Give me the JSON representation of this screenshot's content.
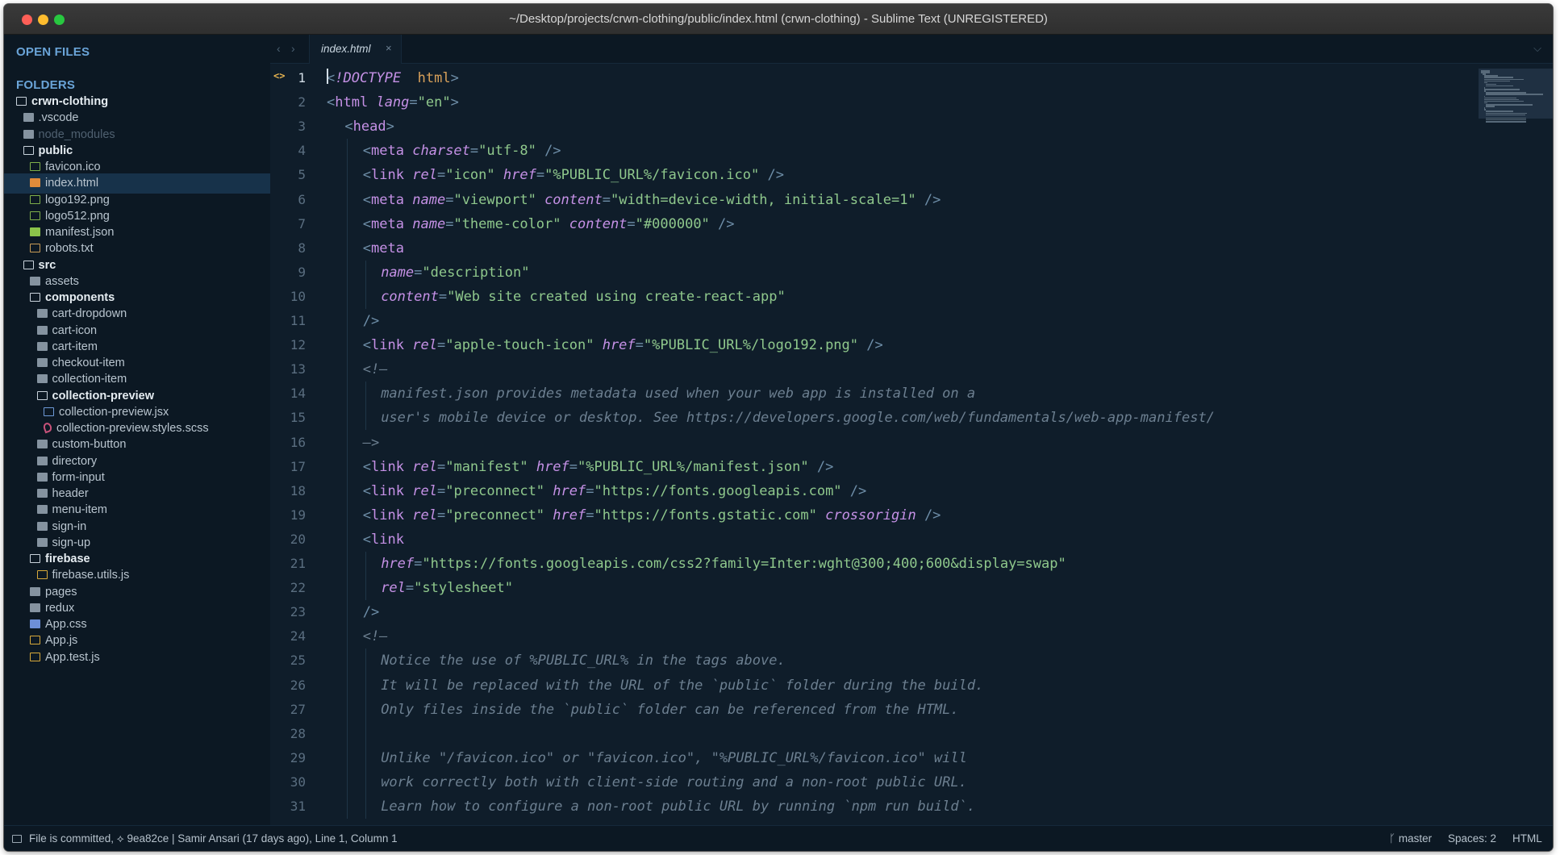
{
  "window": {
    "title": "~/Desktop/projects/crwn-clothing/public/index.html (crwn-clothing) - Sublime Text (UNREGISTERED)"
  },
  "sidebar": {
    "open_files_heading": "OPEN FILES",
    "folders_heading": "FOLDERS",
    "tree": [
      {
        "label": "crwn-clothing",
        "indent": 0,
        "icon": "folder-open-icon",
        "kind": "folder-open"
      },
      {
        "label": ".vscode",
        "indent": 1,
        "icon": "folder-icon",
        "kind": "folder"
      },
      {
        "label": "node_modules",
        "indent": 1,
        "icon": "folder-icon",
        "kind": "dim"
      },
      {
        "label": "public",
        "indent": 1,
        "icon": "folder-open-icon",
        "kind": "folder-open"
      },
      {
        "label": "favicon.ico",
        "indent": 2,
        "icon": "image-file-icon",
        "kind": "file"
      },
      {
        "label": "index.html",
        "indent": 2,
        "icon": "html-file-icon",
        "kind": "file",
        "selected": true
      },
      {
        "label": "logo192.png",
        "indent": 2,
        "icon": "image-file-icon",
        "kind": "file"
      },
      {
        "label": "logo512.png",
        "indent": 2,
        "icon": "image-file-icon",
        "kind": "file"
      },
      {
        "label": "manifest.json",
        "indent": 2,
        "icon": "json-file-icon",
        "kind": "file"
      },
      {
        "label": "robots.txt",
        "indent": 2,
        "icon": "text-file-icon",
        "kind": "file"
      },
      {
        "label": "src",
        "indent": 1,
        "icon": "folder-open-icon",
        "kind": "folder-open"
      },
      {
        "label": "assets",
        "indent": 2,
        "icon": "folder-icon",
        "kind": "folder"
      },
      {
        "label": "components",
        "indent": 2,
        "icon": "folder-open-icon",
        "kind": "folder-open"
      },
      {
        "label": "cart-dropdown",
        "indent": 3,
        "icon": "folder-icon",
        "kind": "folder"
      },
      {
        "label": "cart-icon",
        "indent": 3,
        "icon": "folder-icon",
        "kind": "folder"
      },
      {
        "label": "cart-item",
        "indent": 3,
        "icon": "folder-icon",
        "kind": "folder"
      },
      {
        "label": "checkout-item",
        "indent": 3,
        "icon": "folder-icon",
        "kind": "folder"
      },
      {
        "label": "collection-item",
        "indent": 3,
        "icon": "folder-icon",
        "kind": "folder"
      },
      {
        "label": "collection-preview",
        "indent": 3,
        "icon": "folder-open-icon",
        "kind": "folder-open"
      },
      {
        "label": "collection-preview.jsx",
        "indent": 4,
        "icon": "jsx-file-icon",
        "kind": "file"
      },
      {
        "label": "collection-preview.styles.scss",
        "indent": 4,
        "icon": "sass-file-icon",
        "kind": "file"
      },
      {
        "label": "custom-button",
        "indent": 3,
        "icon": "folder-icon",
        "kind": "folder"
      },
      {
        "label": "directory",
        "indent": 3,
        "icon": "folder-icon",
        "kind": "folder"
      },
      {
        "label": "form-input",
        "indent": 3,
        "icon": "folder-icon",
        "kind": "folder"
      },
      {
        "label": "header",
        "indent": 3,
        "icon": "folder-icon",
        "kind": "folder"
      },
      {
        "label": "menu-item",
        "indent": 3,
        "icon": "folder-icon",
        "kind": "folder"
      },
      {
        "label": "sign-in",
        "indent": 3,
        "icon": "folder-icon",
        "kind": "folder"
      },
      {
        "label": "sign-up",
        "indent": 3,
        "icon": "folder-icon",
        "kind": "folder"
      },
      {
        "label": "firebase",
        "indent": 2,
        "icon": "folder-open-icon",
        "kind": "folder-open"
      },
      {
        "label": "firebase.utils.js",
        "indent": 3,
        "icon": "js-file-icon",
        "kind": "file"
      },
      {
        "label": "pages",
        "indent": 2,
        "icon": "folder-icon",
        "kind": "folder"
      },
      {
        "label": "redux",
        "indent": 2,
        "icon": "folder-icon",
        "kind": "folder"
      },
      {
        "label": "App.css",
        "indent": 2,
        "icon": "css-file-icon",
        "kind": "file"
      },
      {
        "label": "App.js",
        "indent": 2,
        "icon": "js-file-icon",
        "kind": "file"
      },
      {
        "label": "App.test.js",
        "indent": 2,
        "icon": "js-test-file-icon",
        "kind": "file"
      }
    ]
  },
  "tabs": [
    {
      "label": "index.html",
      "close": "×",
      "active": true
    }
  ],
  "tab_nav": {
    "back": "‹",
    "forward": "›",
    "dropdown": "⌵"
  },
  "editor": {
    "gutter_marker": "<>",
    "active_line": 1,
    "lines": [
      {
        "n": "1",
        "indent": 0,
        "tokens": [
          [
            "t-punct",
            "<"
          ],
          [
            "t-doc",
            "!DOCTYPE"
          ],
          [
            "",
            "  "
          ],
          [
            "t-name",
            "html"
          ],
          [
            "t-punct",
            ">"
          ]
        ]
      },
      {
        "n": "2",
        "indent": 0,
        "tokens": [
          [
            "t-punct",
            "<"
          ],
          [
            "t-tag",
            "html"
          ],
          [
            "",
            " "
          ],
          [
            "t-attr",
            "lang"
          ],
          [
            "t-punct",
            "="
          ],
          [
            "t-str",
            "\"en\""
          ],
          [
            "t-punct",
            ">"
          ]
        ]
      },
      {
        "n": "3",
        "indent": 1,
        "tokens": [
          [
            "t-punct",
            "<"
          ],
          [
            "t-tag",
            "head"
          ],
          [
            "t-punct",
            ">"
          ]
        ]
      },
      {
        "n": "4",
        "indent": 2,
        "tokens": [
          [
            "t-punct",
            "<"
          ],
          [
            "t-tag",
            "meta"
          ],
          [
            "",
            " "
          ],
          [
            "t-attr",
            "charset"
          ],
          [
            "t-punct",
            "="
          ],
          [
            "t-str",
            "\"utf-8\""
          ],
          [
            "",
            " "
          ],
          [
            "t-punct",
            "/>"
          ]
        ]
      },
      {
        "n": "5",
        "indent": 2,
        "tokens": [
          [
            "t-punct",
            "<"
          ],
          [
            "t-tag",
            "link"
          ],
          [
            "",
            " "
          ],
          [
            "t-attr",
            "rel"
          ],
          [
            "t-punct",
            "="
          ],
          [
            "t-str",
            "\"icon\""
          ],
          [
            "",
            " "
          ],
          [
            "t-attr",
            "href"
          ],
          [
            "t-punct",
            "="
          ],
          [
            "t-str",
            "\"%PUBLIC_URL%/favicon.ico\""
          ],
          [
            "",
            " "
          ],
          [
            "t-punct",
            "/>"
          ]
        ]
      },
      {
        "n": "6",
        "indent": 2,
        "tokens": [
          [
            "t-punct",
            "<"
          ],
          [
            "t-tag",
            "meta"
          ],
          [
            "",
            " "
          ],
          [
            "t-attr",
            "name"
          ],
          [
            "t-punct",
            "="
          ],
          [
            "t-str",
            "\"viewport\""
          ],
          [
            "",
            " "
          ],
          [
            "t-attr",
            "content"
          ],
          [
            "t-punct",
            "="
          ],
          [
            "t-str",
            "\"width=device-width, initial-scale=1\""
          ],
          [
            "",
            " "
          ],
          [
            "t-punct",
            "/>"
          ]
        ]
      },
      {
        "n": "7",
        "indent": 2,
        "tokens": [
          [
            "t-punct",
            "<"
          ],
          [
            "t-tag",
            "meta"
          ],
          [
            "",
            " "
          ],
          [
            "t-attr",
            "name"
          ],
          [
            "t-punct",
            "="
          ],
          [
            "t-str",
            "\"theme-color\""
          ],
          [
            "",
            " "
          ],
          [
            "t-attr",
            "content"
          ],
          [
            "t-punct",
            "="
          ],
          [
            "t-str",
            "\"#000000\""
          ],
          [
            "",
            " "
          ],
          [
            "t-punct",
            "/>"
          ]
        ]
      },
      {
        "n": "8",
        "indent": 2,
        "tokens": [
          [
            "t-punct",
            "<"
          ],
          [
            "t-tag",
            "meta"
          ]
        ]
      },
      {
        "n": "9",
        "indent": 3,
        "tokens": [
          [
            "t-attr",
            "name"
          ],
          [
            "t-punct",
            "="
          ],
          [
            "t-str",
            "\"description\""
          ]
        ]
      },
      {
        "n": "10",
        "indent": 3,
        "tokens": [
          [
            "t-attr",
            "content"
          ],
          [
            "t-punct",
            "="
          ],
          [
            "t-str",
            "\"Web site created using create-react-app\""
          ]
        ]
      },
      {
        "n": "11",
        "indent": 2,
        "tokens": [
          [
            "t-punct",
            "/>"
          ]
        ]
      },
      {
        "n": "12",
        "indent": 2,
        "tokens": [
          [
            "t-punct",
            "<"
          ],
          [
            "t-tag",
            "link"
          ],
          [
            "",
            " "
          ],
          [
            "t-attr",
            "rel"
          ],
          [
            "t-punct",
            "="
          ],
          [
            "t-str",
            "\"apple-touch-icon\""
          ],
          [
            "",
            " "
          ],
          [
            "t-attr",
            "href"
          ],
          [
            "t-punct",
            "="
          ],
          [
            "t-str",
            "\"%PUBLIC_URL%/logo192.png\""
          ],
          [
            "",
            " "
          ],
          [
            "t-punct",
            "/>"
          ]
        ]
      },
      {
        "n": "13",
        "indent": 2,
        "tokens": [
          [
            "t-com",
            "<!—"
          ]
        ]
      },
      {
        "n": "14",
        "indent": 3,
        "tokens": [
          [
            "t-com",
            "manifest.json provides metadata used when your web app is installed on a"
          ]
        ]
      },
      {
        "n": "15",
        "indent": 3,
        "tokens": [
          [
            "t-com",
            "user's mobile device or desktop. See https://developers.google.com/web/fundamentals/web-app-manifest/"
          ]
        ]
      },
      {
        "n": "16",
        "indent": 2,
        "tokens": [
          [
            "t-com",
            "—>"
          ]
        ]
      },
      {
        "n": "17",
        "indent": 2,
        "tokens": [
          [
            "t-punct",
            "<"
          ],
          [
            "t-tag",
            "link"
          ],
          [
            "",
            " "
          ],
          [
            "t-attr",
            "rel"
          ],
          [
            "t-punct",
            "="
          ],
          [
            "t-str",
            "\"manifest\""
          ],
          [
            "",
            " "
          ],
          [
            "t-attr",
            "href"
          ],
          [
            "t-punct",
            "="
          ],
          [
            "t-str",
            "\"%PUBLIC_URL%/manifest.json\""
          ],
          [
            "",
            " "
          ],
          [
            "t-punct",
            "/>"
          ]
        ]
      },
      {
        "n": "18",
        "indent": 2,
        "tokens": [
          [
            "t-punct",
            "<"
          ],
          [
            "t-tag",
            "link"
          ],
          [
            "",
            " "
          ],
          [
            "t-attr",
            "rel"
          ],
          [
            "t-punct",
            "="
          ],
          [
            "t-str",
            "\"preconnect\""
          ],
          [
            "",
            " "
          ],
          [
            "t-attr",
            "href"
          ],
          [
            "t-punct",
            "="
          ],
          [
            "t-str",
            "\"https://fonts.googleapis.com\""
          ],
          [
            "",
            " "
          ],
          [
            "t-punct",
            "/>"
          ]
        ]
      },
      {
        "n": "19",
        "indent": 2,
        "tokens": [
          [
            "t-punct",
            "<"
          ],
          [
            "t-tag",
            "link"
          ],
          [
            "",
            " "
          ],
          [
            "t-attr",
            "rel"
          ],
          [
            "t-punct",
            "="
          ],
          [
            "t-str",
            "\"preconnect\""
          ],
          [
            "",
            " "
          ],
          [
            "t-attr",
            "href"
          ],
          [
            "t-punct",
            "="
          ],
          [
            "t-str",
            "\"https://fonts.gstatic.com\""
          ],
          [
            "",
            " "
          ],
          [
            "t-attr",
            "crossorigin"
          ],
          [
            "",
            " "
          ],
          [
            "t-punct",
            "/>"
          ]
        ]
      },
      {
        "n": "20",
        "indent": 2,
        "tokens": [
          [
            "t-punct",
            "<"
          ],
          [
            "t-tag",
            "link"
          ]
        ]
      },
      {
        "n": "21",
        "indent": 3,
        "tokens": [
          [
            "t-attr",
            "href"
          ],
          [
            "t-punct",
            "="
          ],
          [
            "t-str",
            "\"https://fonts.googleapis.com/css2?family=Inter:wght@300;400;600&display=swap\""
          ]
        ]
      },
      {
        "n": "22",
        "indent": 3,
        "tokens": [
          [
            "t-attr",
            "rel"
          ],
          [
            "t-punct",
            "="
          ],
          [
            "t-str",
            "\"stylesheet\""
          ]
        ]
      },
      {
        "n": "23",
        "indent": 2,
        "tokens": [
          [
            "t-punct",
            "/>"
          ]
        ]
      },
      {
        "n": "24",
        "indent": 2,
        "tokens": [
          [
            "t-com",
            "<!—"
          ]
        ]
      },
      {
        "n": "25",
        "indent": 3,
        "tokens": [
          [
            "t-com",
            "Notice the use of %PUBLIC_URL% in the tags above."
          ]
        ]
      },
      {
        "n": "26",
        "indent": 3,
        "tokens": [
          [
            "t-com",
            "It will be replaced with the URL of the `public` folder during the build."
          ]
        ]
      },
      {
        "n": "27",
        "indent": 3,
        "tokens": [
          [
            "t-com",
            "Only files inside the `public` folder can be referenced from the HTML."
          ]
        ]
      },
      {
        "n": "28",
        "indent": 3,
        "tokens": []
      },
      {
        "n": "29",
        "indent": 3,
        "tokens": [
          [
            "t-com",
            "Unlike \"/favicon.ico\" or \"favicon.ico\", \"%PUBLIC_URL%/favicon.ico\" will"
          ]
        ]
      },
      {
        "n": "30",
        "indent": 3,
        "tokens": [
          [
            "t-com",
            "work correctly both with client-side routing and a non-root public URL."
          ]
        ]
      },
      {
        "n": "31",
        "indent": 3,
        "tokens": [
          [
            "t-com",
            "Learn how to configure a non-root public URL by running `npm run build`."
          ]
        ]
      }
    ]
  },
  "status": {
    "left": "File is committed, ⟡ 9ea82ce | Samir Ansari (17 days ago), Line 1, Column 1",
    "branch": "ᚴ master",
    "spaces": "Spaces: 2",
    "syntax": "HTML"
  },
  "colors": {
    "background": "#0f1d2a",
    "sidebar": "#0c1823",
    "heading": "#6aa4d8",
    "selection": "#17324a",
    "tag": "#c591e6",
    "string": "#8fc88c",
    "doctype_name": "#d7a05a",
    "comment": "#6c7f90"
  }
}
